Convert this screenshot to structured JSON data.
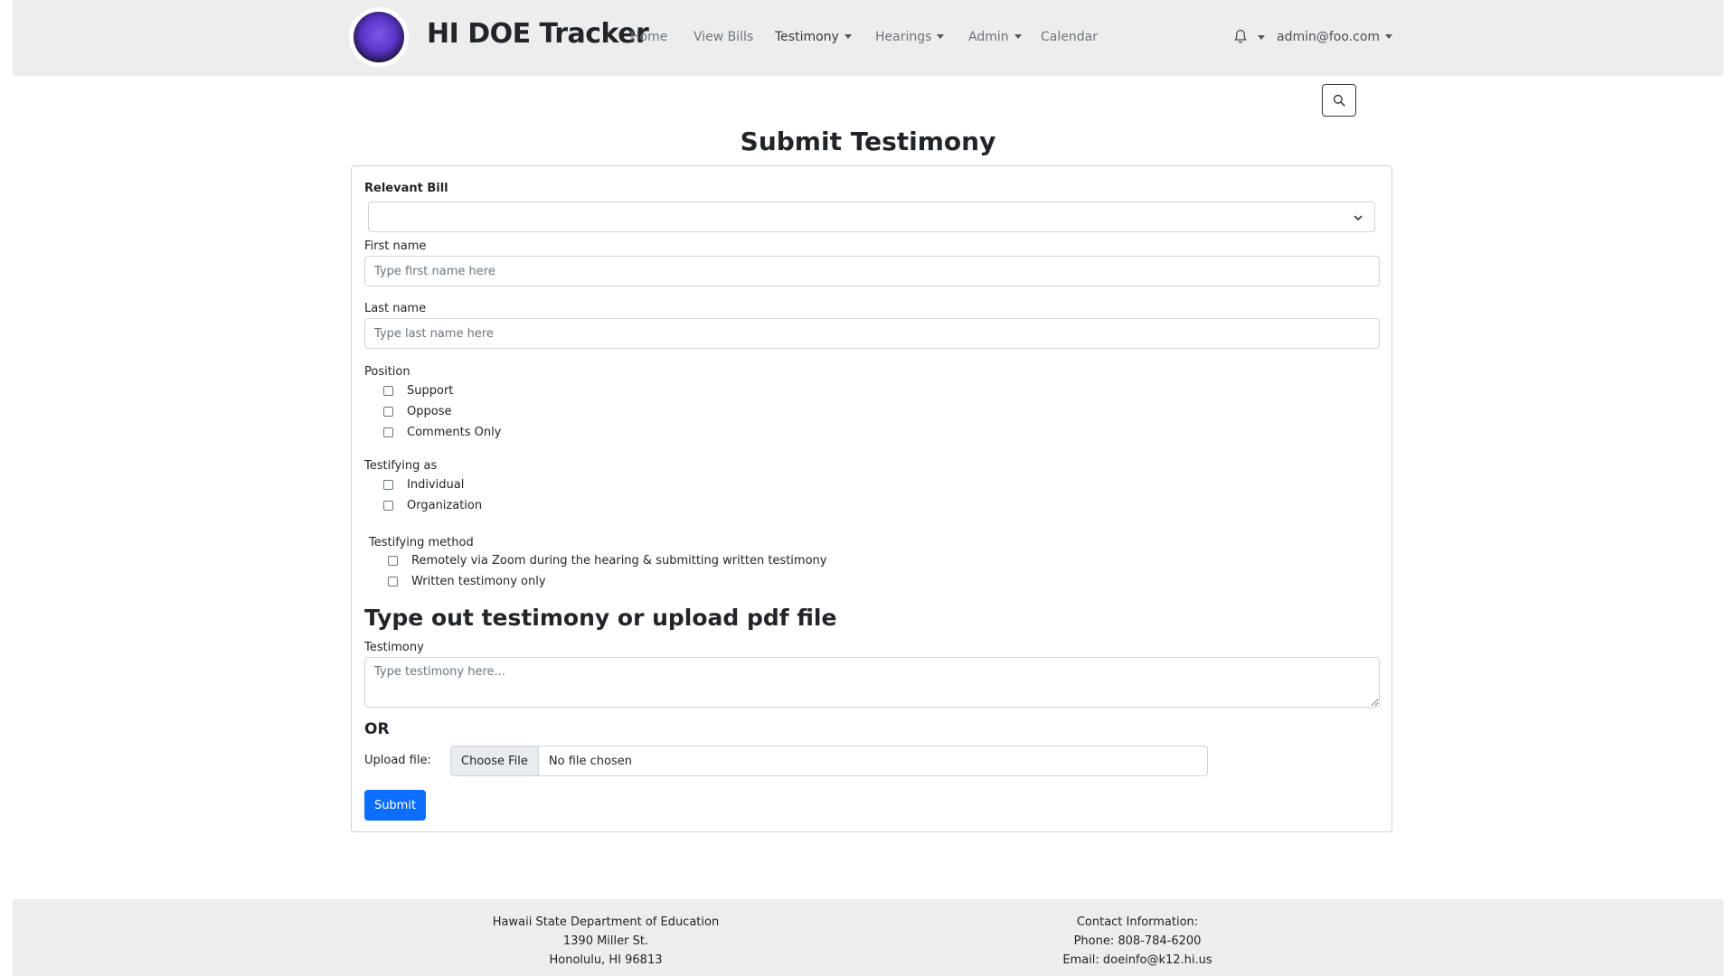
{
  "app": {
    "title": "HI DOE Tracker"
  },
  "nav": {
    "home": "Home",
    "view_bills": "View Bills",
    "testimony": "Testimony",
    "hearings": "Hearings",
    "admin": "Admin",
    "calendar": "Calendar",
    "user": "admin@foo.com"
  },
  "page": {
    "title": "Submit Testimony"
  },
  "form": {
    "relevant_bill_label": "Relevant Bill",
    "relevant_bill_value": "",
    "first_name_label": "First name",
    "first_name_placeholder": "Type first name here",
    "last_name_label": "Last name",
    "last_name_placeholder": "Type last name here",
    "position": {
      "label": "Position",
      "options": [
        "Support",
        "Oppose",
        "Comments Only"
      ]
    },
    "testifying_as": {
      "label": "Testifying as",
      "options": [
        "Individual",
        "Organization"
      ]
    },
    "testifying_method": {
      "label": "Testifying method",
      "options": [
        "Remotely via Zoom during the hearing & submitting written testimony",
        "Written testimony only"
      ]
    },
    "section_heading": "Type out testimony or upload pdf file",
    "testimony_label": "Testimony",
    "testimony_placeholder": "Type testimony here...",
    "or_label": "OR",
    "upload_label": "Upload file:",
    "choose_file": "Choose File",
    "no_file": "No file chosen",
    "submit": "Submit"
  },
  "footer": {
    "left": [
      "Hawaii State Department of Education",
      "1390 Miller St.",
      "Honolulu, HI 96813"
    ],
    "right": [
      "Contact Information:",
      "Phone: 808-784-6200",
      "Email: doeinfo@k12.hi.us"
    ]
  },
  "colors": {
    "primary": "#0d6efd",
    "navbar_bg": "#ededed",
    "logo_accent": "#6a45d8"
  },
  "icons": {
    "notifications": "bell-icon",
    "search": "search-icon",
    "select": "chevron-down-icon"
  }
}
